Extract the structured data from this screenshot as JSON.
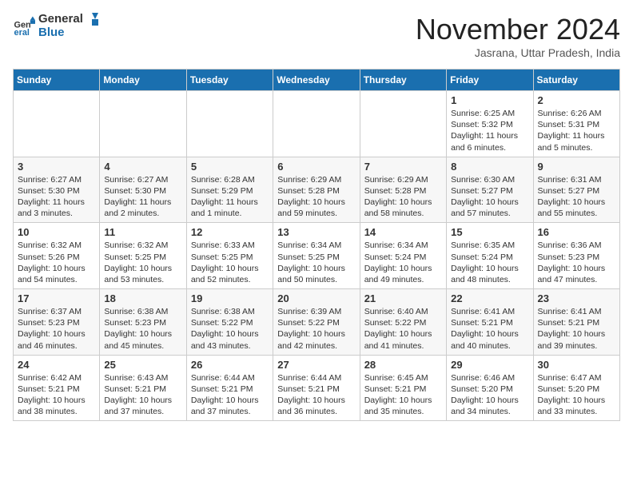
{
  "logo": {
    "line1": "General",
    "line2": "Blue"
  },
  "title": "November 2024",
  "subtitle": "Jasrana, Uttar Pradesh, India",
  "weekdays": [
    "Sunday",
    "Monday",
    "Tuesday",
    "Wednesday",
    "Thursday",
    "Friday",
    "Saturday"
  ],
  "weeks": [
    [
      {
        "day": "",
        "text": ""
      },
      {
        "day": "",
        "text": ""
      },
      {
        "day": "",
        "text": ""
      },
      {
        "day": "",
        "text": ""
      },
      {
        "day": "",
        "text": ""
      },
      {
        "day": "1",
        "text": "Sunrise: 6:25 AM\nSunset: 5:32 PM\nDaylight: 11 hours and 6 minutes."
      },
      {
        "day": "2",
        "text": "Sunrise: 6:26 AM\nSunset: 5:31 PM\nDaylight: 11 hours and 5 minutes."
      }
    ],
    [
      {
        "day": "3",
        "text": "Sunrise: 6:27 AM\nSunset: 5:30 PM\nDaylight: 11 hours and 3 minutes."
      },
      {
        "day": "4",
        "text": "Sunrise: 6:27 AM\nSunset: 5:30 PM\nDaylight: 11 hours and 2 minutes."
      },
      {
        "day": "5",
        "text": "Sunrise: 6:28 AM\nSunset: 5:29 PM\nDaylight: 11 hours and 1 minute."
      },
      {
        "day": "6",
        "text": "Sunrise: 6:29 AM\nSunset: 5:28 PM\nDaylight: 10 hours and 59 minutes."
      },
      {
        "day": "7",
        "text": "Sunrise: 6:29 AM\nSunset: 5:28 PM\nDaylight: 10 hours and 58 minutes."
      },
      {
        "day": "8",
        "text": "Sunrise: 6:30 AM\nSunset: 5:27 PM\nDaylight: 10 hours and 57 minutes."
      },
      {
        "day": "9",
        "text": "Sunrise: 6:31 AM\nSunset: 5:27 PM\nDaylight: 10 hours and 55 minutes."
      }
    ],
    [
      {
        "day": "10",
        "text": "Sunrise: 6:32 AM\nSunset: 5:26 PM\nDaylight: 10 hours and 54 minutes."
      },
      {
        "day": "11",
        "text": "Sunrise: 6:32 AM\nSunset: 5:25 PM\nDaylight: 10 hours and 53 minutes."
      },
      {
        "day": "12",
        "text": "Sunrise: 6:33 AM\nSunset: 5:25 PM\nDaylight: 10 hours and 52 minutes."
      },
      {
        "day": "13",
        "text": "Sunrise: 6:34 AM\nSunset: 5:25 PM\nDaylight: 10 hours and 50 minutes."
      },
      {
        "day": "14",
        "text": "Sunrise: 6:34 AM\nSunset: 5:24 PM\nDaylight: 10 hours and 49 minutes."
      },
      {
        "day": "15",
        "text": "Sunrise: 6:35 AM\nSunset: 5:24 PM\nDaylight: 10 hours and 48 minutes."
      },
      {
        "day": "16",
        "text": "Sunrise: 6:36 AM\nSunset: 5:23 PM\nDaylight: 10 hours and 47 minutes."
      }
    ],
    [
      {
        "day": "17",
        "text": "Sunrise: 6:37 AM\nSunset: 5:23 PM\nDaylight: 10 hours and 46 minutes."
      },
      {
        "day": "18",
        "text": "Sunrise: 6:38 AM\nSunset: 5:23 PM\nDaylight: 10 hours and 45 minutes."
      },
      {
        "day": "19",
        "text": "Sunrise: 6:38 AM\nSunset: 5:22 PM\nDaylight: 10 hours and 43 minutes."
      },
      {
        "day": "20",
        "text": "Sunrise: 6:39 AM\nSunset: 5:22 PM\nDaylight: 10 hours and 42 minutes."
      },
      {
        "day": "21",
        "text": "Sunrise: 6:40 AM\nSunset: 5:22 PM\nDaylight: 10 hours and 41 minutes."
      },
      {
        "day": "22",
        "text": "Sunrise: 6:41 AM\nSunset: 5:21 PM\nDaylight: 10 hours and 40 minutes."
      },
      {
        "day": "23",
        "text": "Sunrise: 6:41 AM\nSunset: 5:21 PM\nDaylight: 10 hours and 39 minutes."
      }
    ],
    [
      {
        "day": "24",
        "text": "Sunrise: 6:42 AM\nSunset: 5:21 PM\nDaylight: 10 hours and 38 minutes."
      },
      {
        "day": "25",
        "text": "Sunrise: 6:43 AM\nSunset: 5:21 PM\nDaylight: 10 hours and 37 minutes."
      },
      {
        "day": "26",
        "text": "Sunrise: 6:44 AM\nSunset: 5:21 PM\nDaylight: 10 hours and 37 minutes."
      },
      {
        "day": "27",
        "text": "Sunrise: 6:44 AM\nSunset: 5:21 PM\nDaylight: 10 hours and 36 minutes."
      },
      {
        "day": "28",
        "text": "Sunrise: 6:45 AM\nSunset: 5:21 PM\nDaylight: 10 hours and 35 minutes."
      },
      {
        "day": "29",
        "text": "Sunrise: 6:46 AM\nSunset: 5:20 PM\nDaylight: 10 hours and 34 minutes."
      },
      {
        "day": "30",
        "text": "Sunrise: 6:47 AM\nSunset: 5:20 PM\nDaylight: 10 hours and 33 minutes."
      }
    ]
  ]
}
